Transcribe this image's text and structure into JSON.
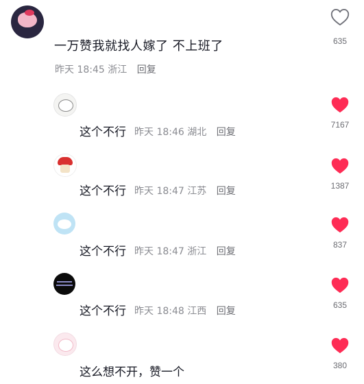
{
  "main_comment": {
    "text": "一万赞我就找人嫁了 不上班了",
    "time": "昨天 18:45",
    "location": "浙江",
    "reply_label": "回复",
    "likes": "635",
    "liked": false
  },
  "replies": [
    {
      "text": "这个不行",
      "time": "昨天 18:46",
      "location": "湖北",
      "reply_label": "回复",
      "likes": "7167",
      "liked": true
    },
    {
      "text": "这个不行",
      "time": "昨天 18:47",
      "location": "江苏",
      "reply_label": "回复",
      "likes": "1387",
      "liked": true
    },
    {
      "text": "这个不行",
      "time": "昨天 18:47",
      "location": "浙江",
      "reply_label": "回复",
      "likes": "837",
      "liked": true
    },
    {
      "text": "这个不行",
      "time": "昨天 18:48",
      "location": "江西",
      "reply_label": "回复",
      "likes": "635",
      "liked": true
    },
    {
      "text": "这么想不开，赞一个",
      "likes": "380",
      "liked": true
    }
  ],
  "colors": {
    "like_red": "#fe2c55",
    "meta_gray": "#8a8b91"
  }
}
